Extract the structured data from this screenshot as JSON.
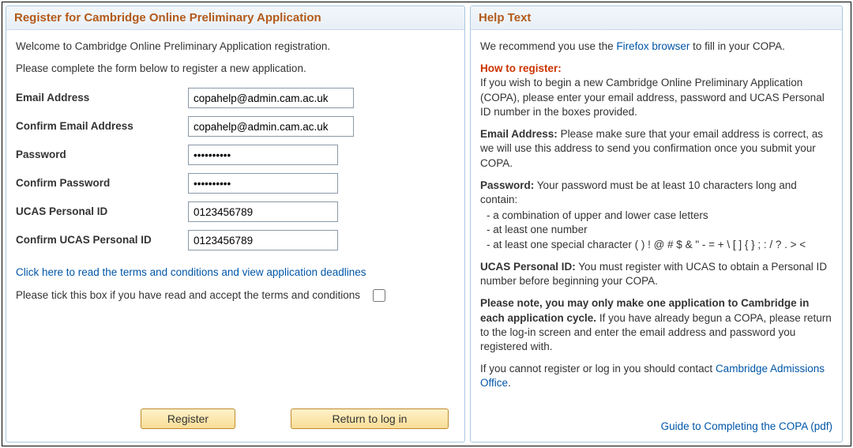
{
  "left": {
    "title": "Register for Cambridge Online Preliminary Application",
    "intro1": "Welcome to Cambridge Online Preliminary Application registration.",
    "intro2": "Please complete the form below to register a new application.",
    "labels": {
      "email": "Email Address",
      "confirm_email": "Confirm Email Address",
      "password": "Password",
      "confirm_password": "Confirm Password",
      "ucas": "UCAS Personal ID",
      "confirm_ucas": "Confirm UCAS Personal ID"
    },
    "values": {
      "email": "copahelp@admin.cam.ac.uk",
      "confirm_email": "copahelp@admin.cam.ac.uk",
      "password": "••••••••••",
      "confirm_password": "••••••••••",
      "ucas": "0123456789",
      "confirm_ucas": "0123456789"
    },
    "terms_link": "Click here to read the terms and conditions and view application deadlines",
    "terms_checkbox_label": "Please tick this box if you have read and accept the terms and conditions",
    "btn_register": "Register",
    "btn_return": "Return to log in"
  },
  "right": {
    "title": "Help Text",
    "rec_pre": "We recommend you use the ",
    "rec_link": "Firefox browser",
    "rec_post": " to fill in your COPA.",
    "how_to": "How to register:",
    "how_to_body": "If you wish to begin a new Cambridge Online Preliminary Application (COPA), please enter your email address, password and UCAS Personal ID number in the boxes provided.",
    "email_h": "Email Address:",
    "email_body": " Please make sure that your email address is correct, as we will use this address to send you confirmation once you submit your COPA.",
    "pw_h": "Password:",
    "pw_body": " Your password must be at least 10 characters long and contain:",
    "pw_r1": "- a combination of upper and lower case letters",
    "pw_r2": "- at least one number",
    "pw_r3": "- at least one special character ( ) ! @ # $ & \" - = + \\ [ ] { } ; : / ? . > <",
    "ucas_h": "UCAS Personal ID:",
    "ucas_body": " You must register with UCAS to obtain a Personal ID number before beginning your COPA.",
    "note_h": "Please note, you may only make one application to Cambridge in each application cycle.",
    "note_body": " If you have already begun a COPA, please return to the log-in screen and enter the email address and password you registered with.",
    "contact_pre": "If you cannot register or log in you should contact ",
    "contact_link": "Cambridge Admissions Office",
    "contact_post": ".",
    "guide": "Guide to Completing the COPA (pdf)"
  }
}
